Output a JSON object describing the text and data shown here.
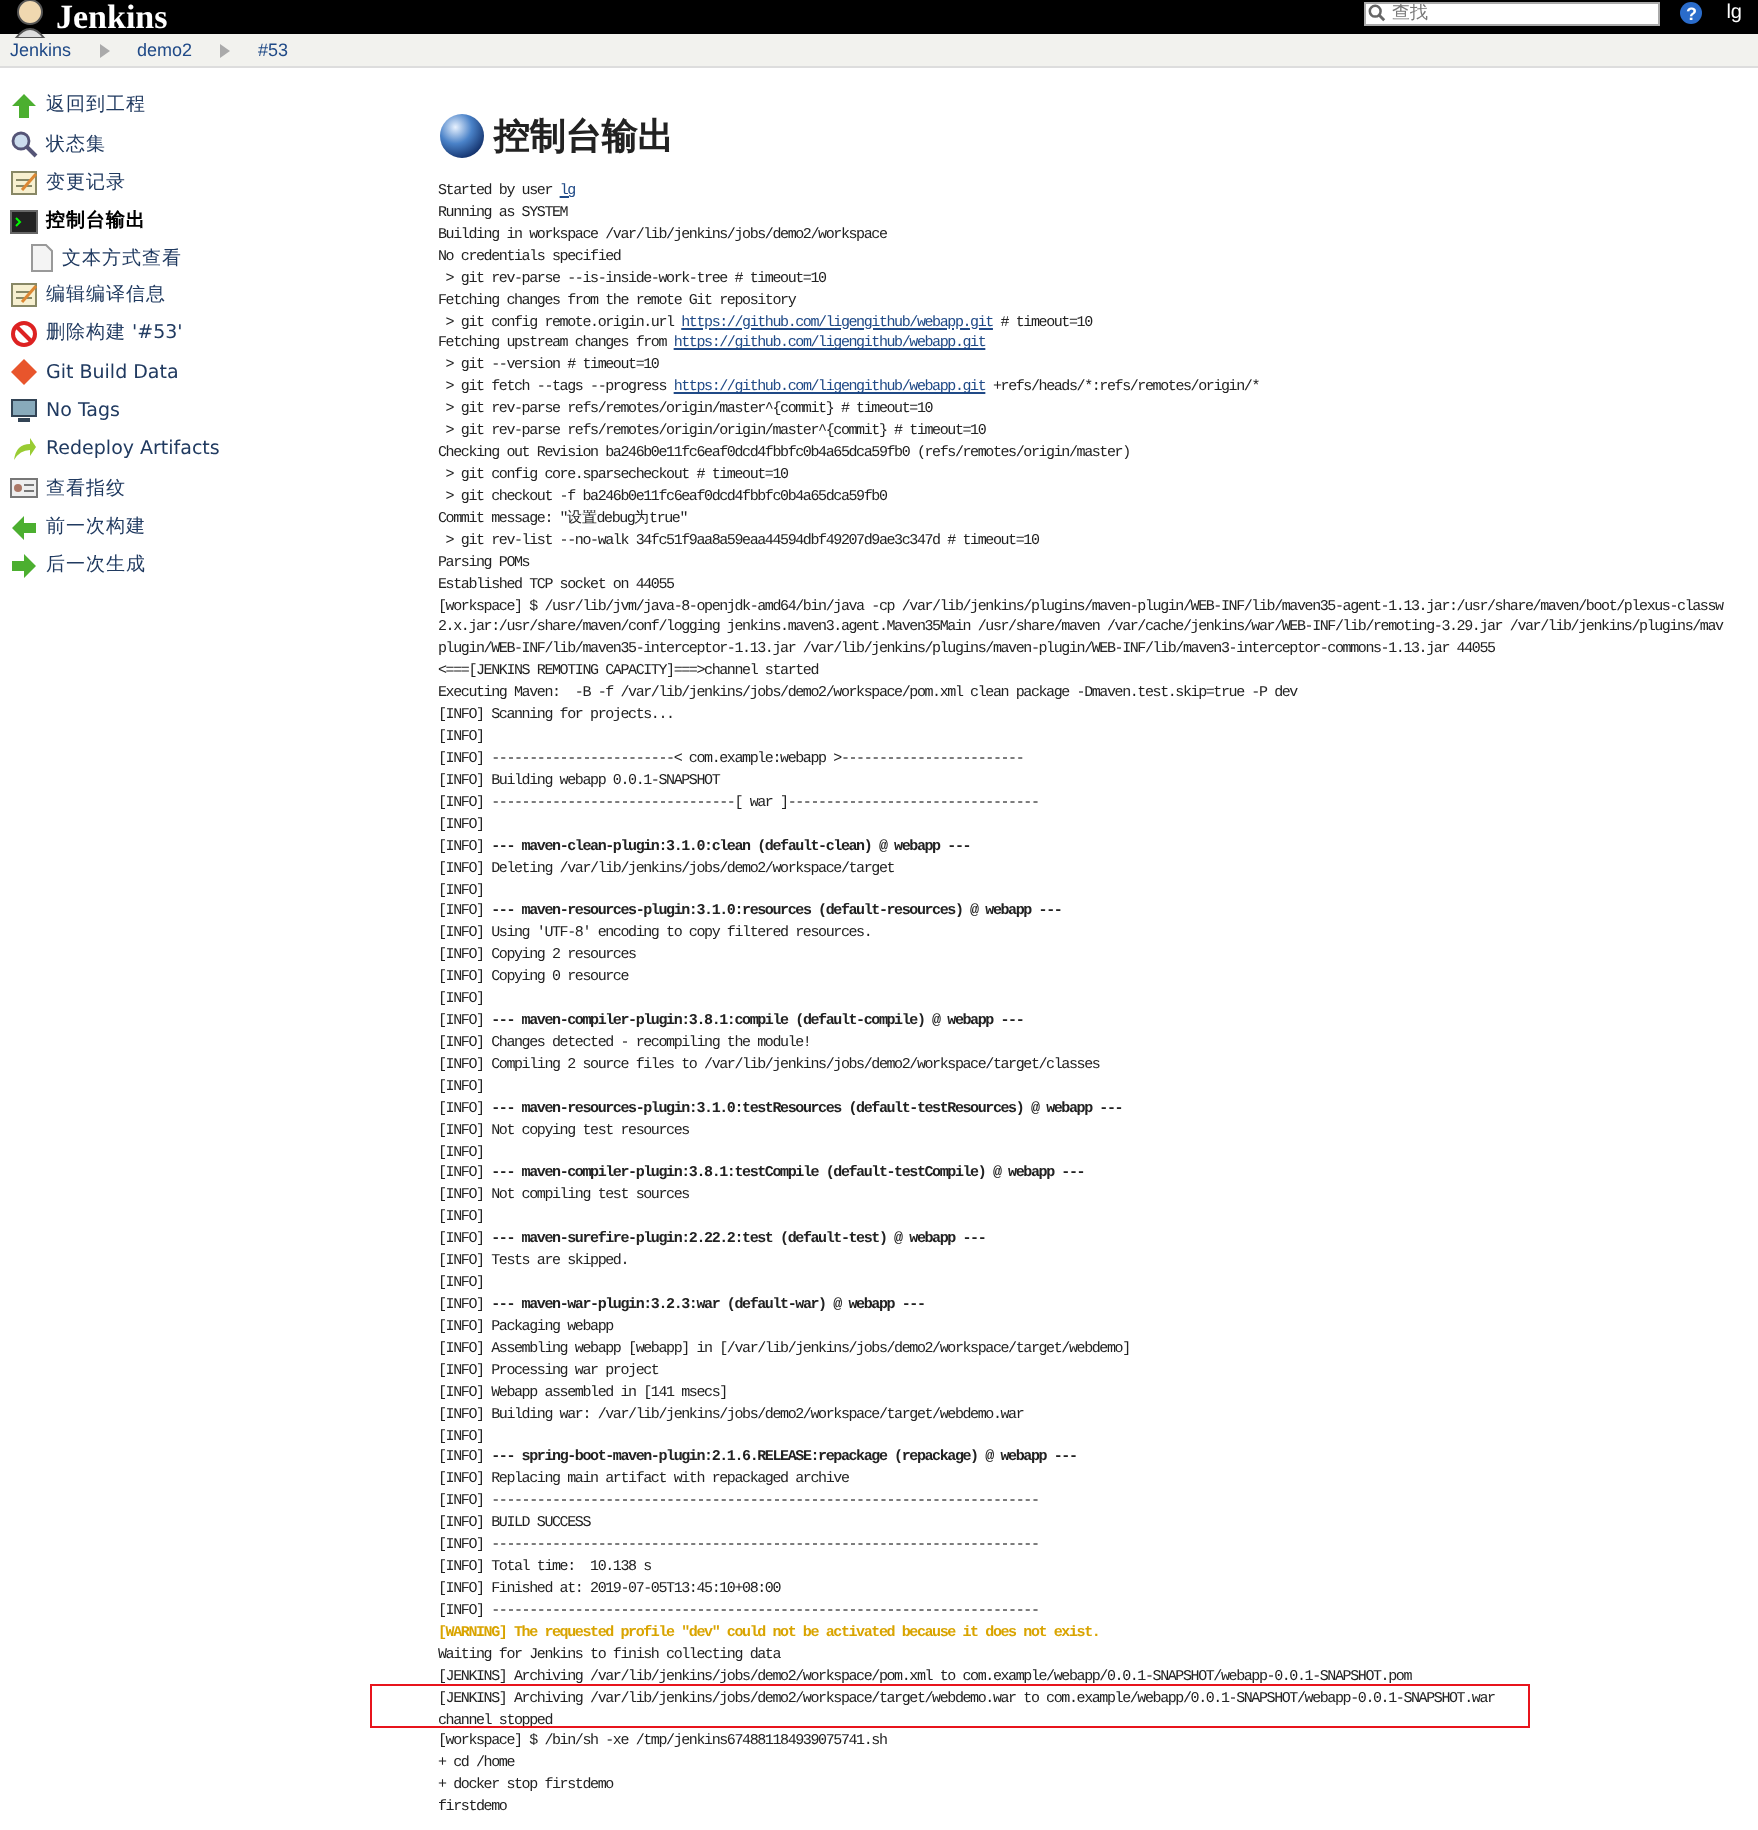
{
  "header": {
    "logo": "Jenkins",
    "search": {
      "placeholder": "查找"
    },
    "help": "?",
    "user": "lg"
  },
  "breadcrumbs": [
    "Jenkins",
    "demo2",
    "#53"
  ],
  "sidebar": {
    "items": [
      {
        "label": "返回到工程",
        "selected": false
      },
      {
        "label": "状态集",
        "selected": false
      },
      {
        "label": "变更记录",
        "selected": false
      },
      {
        "label": "控制台输出",
        "selected": true,
        "children": [
          {
            "label": "文本方式查看",
            "selected": false
          }
        ]
      },
      {
        "label": "编辑编译信息",
        "selected": false
      },
      {
        "label": "删除构建 '#53'",
        "selected": false
      },
      {
        "label": "Git Build Data",
        "selected": false
      },
      {
        "label": "No Tags",
        "selected": false
      },
      {
        "label": "Redeploy Artifacts",
        "selected": false
      },
      {
        "label": "查看指纹",
        "selected": false
      },
      {
        "label": "前一次构建",
        "selected": false
      },
      {
        "label": "后一次生成",
        "selected": false
      }
    ]
  },
  "title": "控制台输出",
  "console": [
    {
      "kind": "link",
      "before": "Started by user ",
      "link": "lg"
    },
    {
      "kind": "text",
      "text": "Running as SYSTEM"
    },
    {
      "kind": "text",
      "text": "Building in workspace /var/lib/jenkins/jobs/demo2/workspace"
    },
    {
      "kind": "text",
      "text": "No credentials specified"
    },
    {
      "kind": "text",
      "text": " > git rev-parse --is-inside-work-tree # timeout=10"
    },
    {
      "kind": "text",
      "text": "Fetching changes from the remote Git repository"
    },
    {
      "kind": "link",
      "before": " > git config remote.origin.url ",
      "link": "https://github.com/ligengithub/webapp.git",
      "after": " # timeout=10"
    },
    {
      "kind": "link",
      "before": "Fetching upstream changes from ",
      "link": "https://github.com/ligengithub/webapp.git"
    },
    {
      "kind": "text",
      "text": " > git --version # timeout=10"
    },
    {
      "kind": "link",
      "before": " > git fetch --tags --progress ",
      "link": "https://github.com/ligengithub/webapp.git",
      "after": " +refs/heads/*:refs/remotes/origin/*"
    },
    {
      "kind": "text",
      "text": " > git rev-parse refs/remotes/origin/master^{commit} # timeout=10"
    },
    {
      "kind": "text",
      "text": " > git rev-parse refs/remotes/origin/origin/master^{commit} # timeout=10"
    },
    {
      "kind": "text",
      "text": "Checking out Revision ba246b0e11fc6eaf0dcd4fbbfc0b4a65dca59fb0 (refs/remotes/origin/master)"
    },
    {
      "kind": "text",
      "text": " > git config core.sparsecheckout # timeout=10"
    },
    {
      "kind": "text",
      "text": " > git checkout -f ba246b0e11fc6eaf0dcd4fbbfc0b4a65dca59fb0"
    },
    {
      "kind": "text",
      "text": "Commit message: \"设置debug为true\""
    },
    {
      "kind": "text",
      "text": " > git rev-list --no-walk 34fc51f9aa8a59eaa44594dbf49207d9ae3c347d # timeout=10"
    },
    {
      "kind": "text",
      "text": "Parsing POMs"
    },
    {
      "kind": "text",
      "text": "Established TCP socket on 44055"
    },
    {
      "kind": "text",
      "text": "[workspace] $ /usr/lib/jvm/java-8-openjdk-amd64/bin/java -cp /var/lib/jenkins/plugins/maven-plugin/WEB-INF/lib/maven35-agent-1.13.jar:/usr/share/maven/boot/plexus-classw"
    },
    {
      "kind": "text",
      "text": "2.x.jar:/usr/share/maven/conf/logging jenkins.maven3.agent.Maven35Main /usr/share/maven /var/cache/jenkins/war/WEB-INF/lib/remoting-3.29.jar /var/lib/jenkins/plugins/mav"
    },
    {
      "kind": "text",
      "text": "plugin/WEB-INF/lib/maven35-interceptor-1.13.jar /var/lib/jenkins/plugins/maven-plugin/WEB-INF/lib/maven3-interceptor-commons-1.13.jar 44055"
    },
    {
      "kind": "text",
      "text": "<===[JENKINS REMOTING CAPACITY]===>channel started"
    },
    {
      "kind": "text",
      "text": "Executing Maven:  -B -f /var/lib/jenkins/jobs/demo2/workspace/pom.xml clean package -Dmaven.test.skip=true -P dev"
    },
    {
      "kind": "text",
      "text": "[INFO] Scanning for projects..."
    },
    {
      "kind": "text",
      "text": "[INFO]"
    },
    {
      "kind": "text",
      "text": "[INFO] ------------------------< com.example:webapp >------------------------"
    },
    {
      "kind": "text",
      "text": "[INFO] Building webapp 0.0.1-SNAPSHOT"
    },
    {
      "kind": "text",
      "text": "[INFO] --------------------------------[ war ]---------------------------------"
    },
    {
      "kind": "text",
      "text": "[INFO]"
    },
    {
      "kind": "text",
      "text": "[INFO] **--- maven-clean-plugin:3.1.0:clean (default-clean) @ webapp ---**"
    },
    {
      "kind": "text",
      "text": "[INFO] Deleting /var/lib/jenkins/jobs/demo2/workspace/target"
    },
    {
      "kind": "text",
      "text": "[INFO]"
    },
    {
      "kind": "text",
      "text": "[INFO] **--- maven-resources-plugin:3.1.0:resources (default-resources) @ webapp ---**"
    },
    {
      "kind": "text",
      "text": "[INFO] Using 'UTF-8' encoding to copy filtered resources."
    },
    {
      "kind": "text",
      "text": "[INFO] Copying 2 resources"
    },
    {
      "kind": "text",
      "text": "[INFO] Copying 0 resource"
    },
    {
      "kind": "text",
      "text": "[INFO]"
    },
    {
      "kind": "text",
      "text": "[INFO] **--- maven-compiler-plugin:3.8.1:compile (default-compile) @ webapp ---**"
    },
    {
      "kind": "text",
      "text": "[INFO] Changes detected - recompiling the module!"
    },
    {
      "kind": "text",
      "text": "[INFO] Compiling 2 source files to /var/lib/jenkins/jobs/demo2/workspace/target/classes"
    },
    {
      "kind": "text",
      "text": "[INFO]"
    },
    {
      "kind": "text",
      "text": "[INFO] **--- maven-resources-plugin:3.1.0:testResources (default-testResources) @ webapp ---**"
    },
    {
      "kind": "text",
      "text": "[INFO] Not copying test resources"
    },
    {
      "kind": "text",
      "text": "[INFO]"
    },
    {
      "kind": "text",
      "text": "[INFO] **--- maven-compiler-plugin:3.8.1:testCompile (default-testCompile) @ webapp ---**"
    },
    {
      "kind": "text",
      "text": "[INFO] Not compiling test sources"
    },
    {
      "kind": "text",
      "text": "[INFO]"
    },
    {
      "kind": "text",
      "text": "[INFO] **--- maven-surefire-plugin:2.22.2:test (default-test) @ webapp ---**"
    },
    {
      "kind": "text",
      "text": "[INFO] Tests are skipped."
    },
    {
      "kind": "text",
      "text": "[INFO]"
    },
    {
      "kind": "text",
      "text": "[INFO] **--- maven-war-plugin:3.2.3:war (default-war) @ webapp ---**"
    },
    {
      "kind": "text",
      "text": "[INFO] Packaging webapp"
    },
    {
      "kind": "text",
      "text": "[INFO] Assembling webapp [webapp] in [/var/lib/jenkins/jobs/demo2/workspace/target/webdemo]"
    },
    {
      "kind": "text",
      "text": "[INFO] Processing war project"
    },
    {
      "kind": "text",
      "text": "[INFO] Webapp assembled in [141 msecs]"
    },
    {
      "kind": "text",
      "text": "[INFO] Building war: /var/lib/jenkins/jobs/demo2/workspace/target/webdemo.war"
    },
    {
      "kind": "text",
      "text": "[INFO]"
    },
    {
      "kind": "text",
      "text": "[INFO] **--- spring-boot-maven-plugin:2.1.6.RELEASE:repackage (repackage) @ webapp ---**"
    },
    {
      "kind": "text",
      "text": "[INFO] Replacing main artifact with repackaged archive"
    },
    {
      "kind": "text",
      "text": "[INFO] ------------------------------------------------------------------------"
    },
    {
      "kind": "text",
      "text": "[INFO] BUILD SUCCESS"
    },
    {
      "kind": "text",
      "text": "[INFO] ------------------------------------------------------------------------"
    },
    {
      "kind": "text",
      "text": "[INFO] Total time:  10.138 s"
    },
    {
      "kind": "text",
      "text": "[INFO] Finished at: 2019-07-05T13:45:10+08:00"
    },
    {
      "kind": "text",
      "text": "[INFO] ------------------------------------------------------------------------"
    },
    {
      "kind": "warning",
      "text": "[WARNING] The requested profile \"dev\" could not be activated because it does not exist."
    },
    {
      "kind": "text",
      "text": "Waiting for Jenkins to finish collecting data"
    },
    {
      "kind": "text",
      "text": "[JENKINS] Archiving /var/lib/jenkins/jobs/demo2/workspace/pom.xml to com.example/webapp/0.0.1-SNAPSHOT/webapp-0.0.1-SNAPSHOT.pom"
    },
    {
      "kind": "text",
      "text": "[JENKINS] Archiving /var/lib/jenkins/jobs/demo2/workspace/target/webdemo.war to com.example/webapp/0.0.1-SNAPSHOT/webapp-0.0.1-SNAPSHOT.war"
    },
    {
      "kind": "text",
      "text": "channel stopped"
    },
    {
      "kind": "text",
      "text": "[workspace] $ /bin/sh -xe /tmp/jenkins674881184939075741.sh"
    },
    {
      "kind": "text",
      "text": "+ cd /home"
    },
    {
      "kind": "text",
      "text": "+ docker stop firstdemo"
    },
    {
      "kind": "text",
      "text": "firstdemo"
    }
  ]
}
